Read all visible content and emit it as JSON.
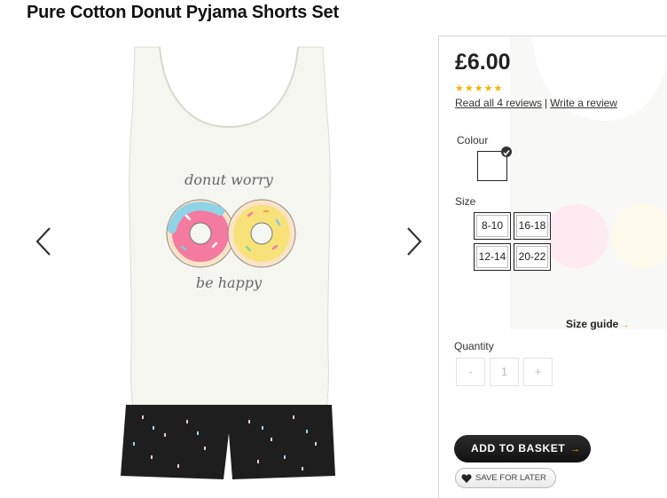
{
  "product": {
    "title": "Pure Cotton Donut Pyjama Shorts Set",
    "print_top": "donut worry",
    "print_bottom": "be happy"
  },
  "gallery": {
    "prev_icon": "chevron-left-icon",
    "next_icon": "chevron-right-icon"
  },
  "buy": {
    "price": "£6.00",
    "stars": "★★★★★",
    "rating": 5,
    "rating_max": 5,
    "read_reviews": "Read all 4 reviews",
    "separator": "|",
    "write_review": "Write a review",
    "colour_label": "Colour",
    "size_label": "Size",
    "sizes": [
      "8-10",
      "16-18",
      "12-14",
      "20-22"
    ],
    "size_guide": "Size guide",
    "size_guide_arrow": "→",
    "quantity_label": "Quantity",
    "qty_minus": "-",
    "qty_value": "1",
    "qty_plus": "+",
    "add_to_basket": "ADD TO BASKET",
    "add_arrow": "→",
    "save_for_later": "SAVE FOR LATER"
  },
  "colors": {
    "star": "#f5b301",
    "accent_arrow": "#f0a500",
    "button_dark": "#1a1a1a",
    "donut_pink": "#f47aa0",
    "donut_yellow": "#f7e27a",
    "shorts": "#1e1e1e"
  }
}
